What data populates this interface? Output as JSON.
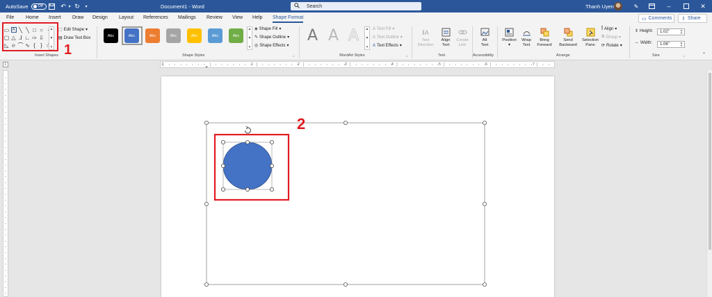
{
  "titlebar": {
    "autosave_label": "AutoSave",
    "autosave_state": "Off",
    "doc_title": "Document1  -  Word",
    "search_placeholder": "Search",
    "user_name": "Thanh Uyen",
    "bg_color": "#2b579a"
  },
  "tabs": [
    "File",
    "Home",
    "Insert",
    "Draw",
    "Design",
    "Layout",
    "References",
    "Mailings",
    "Review",
    "View",
    "Help",
    "Shape Format"
  ],
  "active_tab": "Shape Format",
  "top_buttons": {
    "comments": "Comments",
    "share": "Share"
  },
  "ribbon": {
    "insert_shapes": {
      "label": "Insert Shapes",
      "edit_shape": "Edit Shape",
      "draw_text_box": "Draw Text Box"
    },
    "shape_styles": {
      "label": "Shape Styles",
      "swatch_text": "Abc",
      "swatch_colors": [
        "#000000",
        "#4472c4",
        "#ed7d31",
        "#a5a5a5",
        "#ffc000",
        "#5b9bd5",
        "#70ad47"
      ],
      "selected_index": 1,
      "shape_fill": "Shape Fill",
      "shape_outline": "Shape Outline",
      "shape_effects": "Shape Effects"
    },
    "wordart_styles": {
      "label": "WordArt Styles",
      "letter": "A",
      "text_fill": "Text Fill",
      "text_outline": "Text Outline",
      "text_effects": "Text Effects"
    },
    "text": {
      "label": "Text",
      "text_direction_1": "Text",
      "text_direction_2": "Direction",
      "align_text_1": "Align",
      "align_text_2": "Text",
      "create_link_1": "Create",
      "create_link_2": "Link"
    },
    "accessibility": {
      "label": "Accessibility",
      "alt_text_1": "Alt",
      "alt_text_2": "Text"
    },
    "arrange": {
      "label": "Arrange",
      "position": "Position",
      "wrap_text_1": "Wrap",
      "wrap_text_2": "Text",
      "bring_forward_1": "Bring",
      "bring_forward_2": "Forward",
      "send_backward_1": "Send",
      "send_backward_2": "Backward",
      "selection_pane_1": "Selection",
      "selection_pane_2": "Pane",
      "align": "Align",
      "group": "Group",
      "rotate": "Rotate"
    },
    "size": {
      "label": "Size",
      "height_label": "Height:",
      "height_value": "1.02\"",
      "width_label": "Width:",
      "width_value": "1.06\""
    }
  },
  "ruler_marks": [
    "1",
    "1",
    "2",
    "3",
    "4",
    "5",
    "6",
    "7"
  ],
  "document": {
    "circle_color": "#4472c4",
    "annotation_color": "#e11b22"
  },
  "annotations": {
    "one": "1",
    "two": "2"
  }
}
